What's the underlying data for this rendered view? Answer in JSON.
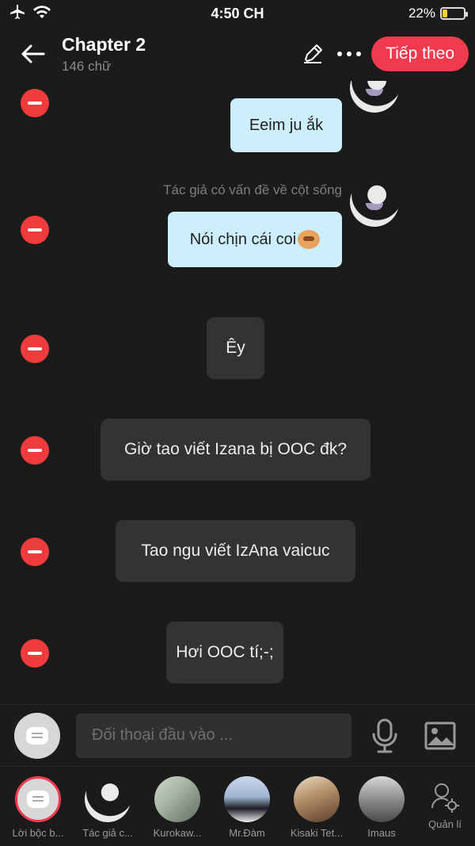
{
  "status": {
    "time": "4:50 CH",
    "battery": "22%"
  },
  "header": {
    "title": "Chapter 2",
    "subtitle": "146 chữ",
    "next_label": "Tiếp theo"
  },
  "messages": [
    {
      "text": "Eeim ju ắk",
      "style": "right"
    },
    {
      "speaker": "Tác giả có vấn đề về cột sống",
      "text": "Nói chịn cái coi",
      "style": "right"
    },
    {
      "text": "Êy",
      "style": "center"
    },
    {
      "text": "Giờ tao viết Izana bị OOC đk?",
      "style": "center"
    },
    {
      "text": "Tao ngu viết IzAna vaicuc",
      "style": "center"
    },
    {
      "text": "Hơi OOC tí;-;",
      "style": "center"
    }
  ],
  "input": {
    "placeholder": "Đối thoại đầu vào ..."
  },
  "characters": [
    {
      "label": "Lời bộc b..."
    },
    {
      "label": "Tác giả c..."
    },
    {
      "label": "Kurokaw..."
    },
    {
      "label": "Mr.Đàm"
    },
    {
      "label": "Kisaki Tet..."
    },
    {
      "label": "Imaus"
    }
  ],
  "manage_label": "Quản lí",
  "colors": {
    "accent": "#f03b4f",
    "bubble_right": "#cdeefc",
    "bubble_center": "#333333",
    "delete": "#ef3b3b"
  }
}
